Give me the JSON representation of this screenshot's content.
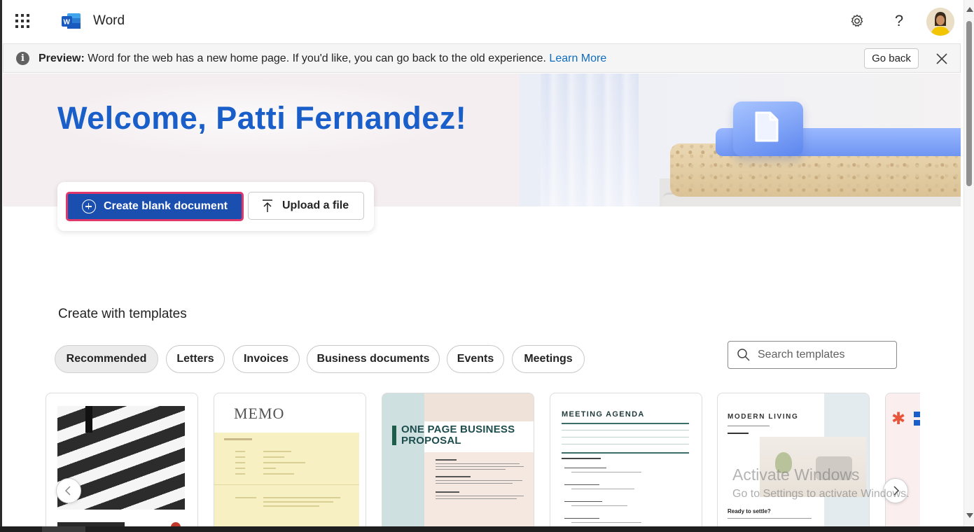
{
  "app": {
    "title": "Word",
    "waffle_icon": "app-launcher-icon",
    "settings_icon": "gear-icon",
    "help_icon": "help-icon",
    "help_glyph": "?"
  },
  "banner": {
    "label": "Preview:",
    "message": " Word for the web has a new home page. If you'd like, you can go back to the old experience. ",
    "link": "Learn More",
    "go_back": "Go back",
    "info_glyph": "i"
  },
  "hero": {
    "welcome": "Welcome, Patti Fernandez!"
  },
  "actions": {
    "create_blank": "Create blank document",
    "upload": "Upload a file"
  },
  "templates": {
    "heading": "Create with templates",
    "search_placeholder": "Search templates",
    "filters": [
      {
        "label": "Recommended",
        "active": true
      },
      {
        "label": "Letters",
        "active": false
      },
      {
        "label": "Invoices",
        "active": false
      },
      {
        "label": "Business documents",
        "active": false
      },
      {
        "label": "Events",
        "active": false
      },
      {
        "label": "Meetings",
        "active": false
      }
    ],
    "cards": [
      {
        "name": "crosswalk-template"
      },
      {
        "name": "memo-template",
        "title": "MEMO"
      },
      {
        "name": "business-proposal-template",
        "title": "ONE PAGE BUSINESS PROPOSAL"
      },
      {
        "name": "meeting-agenda-template",
        "title": "MEETING AGENDA"
      },
      {
        "name": "modern-living-template",
        "title": "MODERN LIVING",
        "subtitle": "Ready to settle?"
      },
      {
        "name": "partial-template"
      }
    ]
  },
  "watermark": {
    "line1": "Activate Windows",
    "line2": "Go to Settings to activate Windows."
  },
  "colors": {
    "accent": "#1a4fb0",
    "focus_ring": "#e0386a",
    "welcome_text": "#1a5fc9",
    "link": "#0f6cbd"
  }
}
